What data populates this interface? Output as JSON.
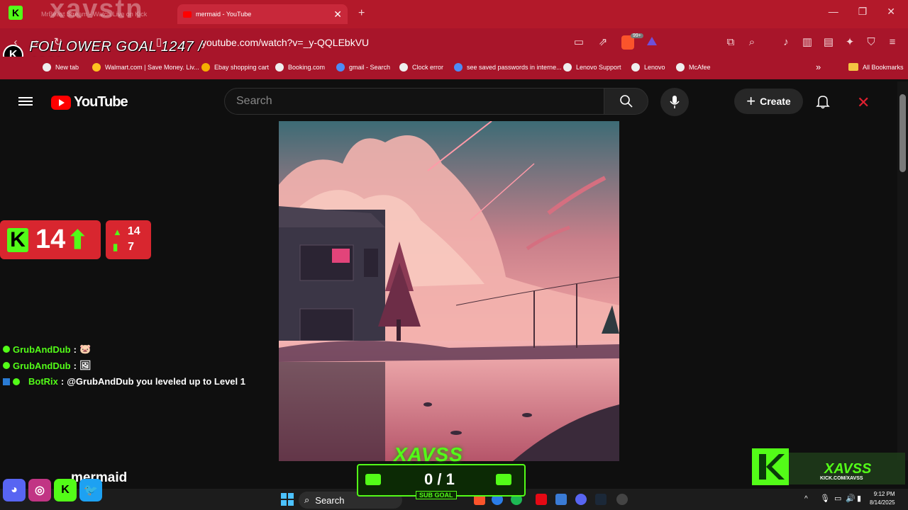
{
  "browser": {
    "tabs": [
      {
        "title": "MrBeast Stream - Watch Live on Kick"
      },
      {
        "title": "mermaid - YouTube"
      }
    ],
    "url": "youtube.com/watch?v=_y-QQLEbkVU",
    "extension_badge": "99+",
    "window_controls": [
      "minimize-icon",
      "maximize-icon",
      "close-icon"
    ],
    "bookmarks": [
      {
        "label": "New tab"
      },
      {
        "label": "Walmart.com | Save Money. Liv..."
      },
      {
        "label": "Ebay shopping cart"
      },
      {
        "label": "Booking.com"
      },
      {
        "label": "gmail - Search"
      },
      {
        "label": "Clock error"
      },
      {
        "label": "see saved passwords in interne..."
      },
      {
        "label": "Lenovo Support"
      },
      {
        "label": "Lenovo"
      },
      {
        "label": "McAfee"
      }
    ],
    "all_bookmarks": "All Bookmarks"
  },
  "overlay": {
    "streamer_watermark": "xavstn",
    "follower_goal": "FOLLOWER GOAL 1247 / 1260",
    "kick_letter": "K",
    "follow_count": "14",
    "stat_up": "14",
    "stat_viewers": "7",
    "chat": [
      {
        "user": "GrubAndDub",
        "sep": ":",
        "msg": "🐷"
      },
      {
        "user": "GrubAndDub",
        "sep": ":",
        "msg": "🖼"
      },
      {
        "user": "BotRix",
        "sep": ":",
        "msg": "@GrubAndDub you leveled up to Level 1"
      }
    ],
    "subgoal_brand": "XAVSS",
    "subgoal_count": "0 / 1",
    "subgoal_label": "SUB GOAL",
    "kick_brand_name": "XAVSS",
    "kick_brand_url": "KICK.COM/XAVSS"
  },
  "youtube": {
    "logo_text": "YouTube",
    "search_placeholder": "Search",
    "create_label": "Create",
    "video_title": "mermaid"
  },
  "taskbar": {
    "search_label": "Search",
    "time": "9:12 PM",
    "date": "8/14/2025"
  },
  "colors": {
    "browser_red": "#b3192a",
    "kick_green": "#53fc18",
    "yt_red": "#ff0000"
  }
}
